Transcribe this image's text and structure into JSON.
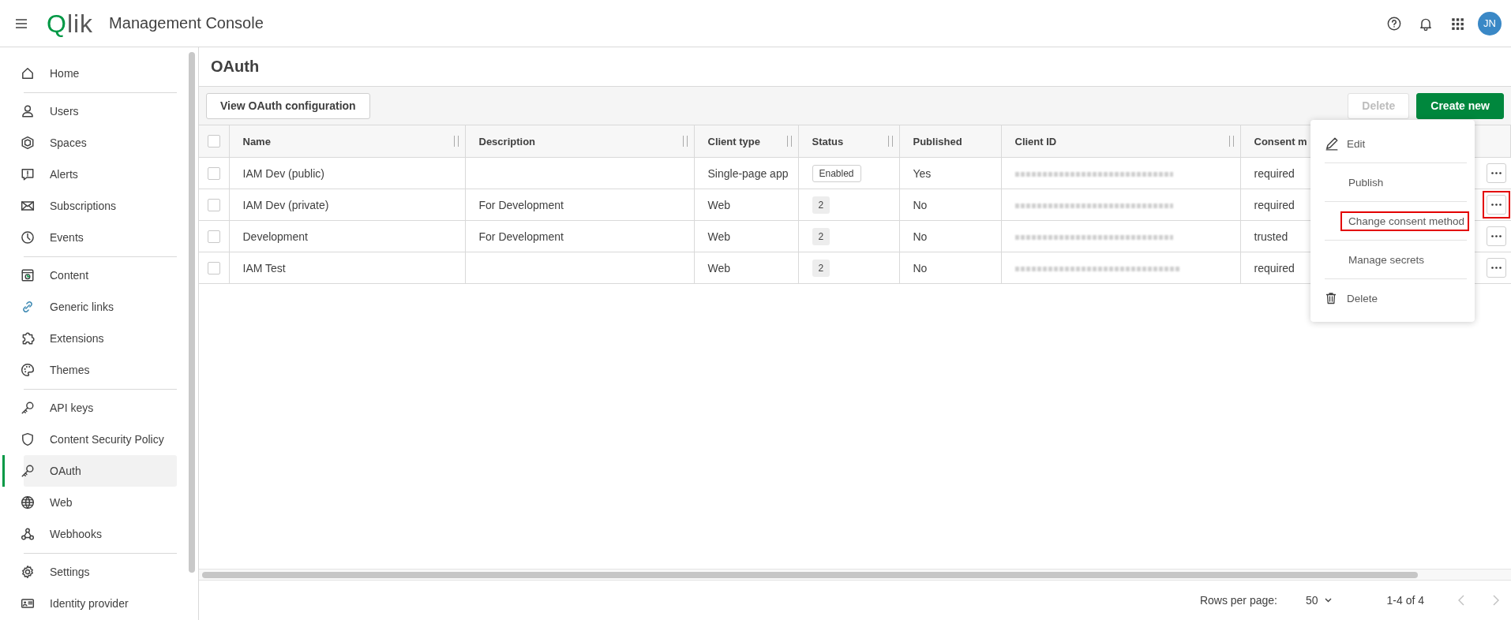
{
  "topbar": {
    "logo": "Qlik",
    "title": "Management Console",
    "avatar": "JN"
  },
  "sidebar": {
    "groups": [
      {
        "items": [
          {
            "label": "Home",
            "selected": false
          }
        ]
      },
      {
        "items": [
          {
            "label": "Users",
            "selected": false
          },
          {
            "label": "Spaces",
            "selected": false
          },
          {
            "label": "Alerts",
            "selected": false
          },
          {
            "label": "Subscriptions",
            "selected": false
          },
          {
            "label": "Events",
            "selected": false
          }
        ]
      },
      {
        "items": [
          {
            "label": "Content",
            "selected": false
          },
          {
            "label": "Generic links",
            "selected": false
          },
          {
            "label": "Extensions",
            "selected": false
          },
          {
            "label": "Themes",
            "selected": false
          }
        ]
      },
      {
        "items": [
          {
            "label": "API keys",
            "selected": false
          },
          {
            "label": "Content Security Policy",
            "selected": false
          },
          {
            "label": "OAuth",
            "selected": true
          },
          {
            "label": "Web",
            "selected": false
          },
          {
            "label": "Webhooks",
            "selected": false
          }
        ]
      },
      {
        "items": [
          {
            "label": "Settings",
            "selected": false
          },
          {
            "label": "Identity provider",
            "selected": false
          }
        ]
      }
    ]
  },
  "page": {
    "title": "OAuth"
  },
  "toolbar": {
    "buttons": [
      {
        "label": "View OAuth configuration",
        "kind": "secondary",
        "disabled": false
      },
      {
        "label": "Delete",
        "kind": "secondary",
        "disabled": true
      },
      {
        "label": "Create new",
        "kind": "primary",
        "disabled": false
      }
    ]
  },
  "table": {
    "all_checked": false,
    "columns": [
      "Name",
      "Description",
      "Client type",
      "Status",
      "Published",
      "Client ID",
      "Consent m"
    ],
    "rows": [
      {
        "checked": false,
        "name": "IAM Dev (public)",
        "description": "",
        "client_type": "Single-page app",
        "status": {
          "label": "Enabled",
          "kind": "outline"
        },
        "published": "Yes",
        "consent": "required",
        "highlighted": false
      },
      {
        "checked": false,
        "name": "IAM Dev (private)",
        "description": "For Development",
        "client_type": "Web",
        "status": {
          "label": "2",
          "kind": "count"
        },
        "published": "No",
        "consent": "required",
        "highlighted": true
      },
      {
        "checked": false,
        "name": "Development",
        "description": "For Development",
        "client_type": "Web",
        "status": {
          "label": "2",
          "kind": "count"
        },
        "published": "No",
        "consent": "trusted",
        "highlighted": false
      },
      {
        "checked": false,
        "name": "IAM Test",
        "description": "",
        "client_type": "Web",
        "status": {
          "label": "2",
          "kind": "count"
        },
        "published": "No",
        "consent": "required",
        "highlighted": false
      }
    ]
  },
  "context_menu": {
    "items": [
      {
        "label": "Edit",
        "kind": "edit",
        "highlighted": false
      },
      {
        "label": "Publish",
        "kind": "plain",
        "highlighted": false
      },
      {
        "label": "Change consent method",
        "kind": "plain",
        "highlighted": true
      },
      {
        "label": "Manage secrets",
        "kind": "plain",
        "highlighted": false
      },
      {
        "label": "Delete",
        "kind": "delete",
        "highlighted": false
      }
    ]
  },
  "footer": {
    "rows_per_page_label": "Rows per page:",
    "rows_per_page": "50",
    "range": "1-4 of 4"
  }
}
